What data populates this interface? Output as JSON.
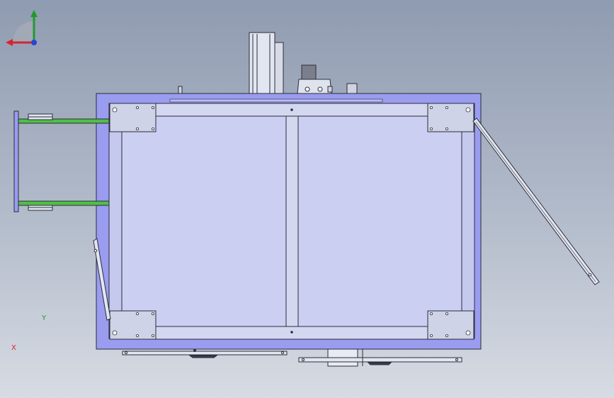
{
  "viewport": {
    "background_top": "#8f9bb0",
    "background_bottom": "#d7dbe3"
  },
  "model": {
    "frame_color": "#9a9cf0",
    "panel_color": "#cbcff2",
    "plate_color": "#cfd3e8",
    "rail_color": "#e2e6f0",
    "arm_color": "#4fbf46",
    "edge_color": "#2b2d3a"
  },
  "triad": {
    "x_label": "X",
    "y_label": "Y",
    "x_color": "#d4262a",
    "y_color": "#1f9a2e",
    "z_color": "#2447d6"
  }
}
